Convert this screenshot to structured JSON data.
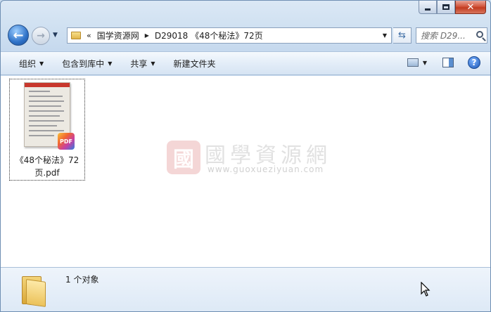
{
  "window": {
    "close_glyph": "✕"
  },
  "nav": {
    "back_glyph": "←",
    "forward_glyph": "→",
    "breadcrumb_sep": "«",
    "breadcrumbs": [
      "国学资源网",
      "D29018 《48个秘法》72页"
    ],
    "search_placeholder": "搜索 D29..."
  },
  "commands": {
    "organize": "组织",
    "include_library": "包含到库中",
    "share": "共享",
    "new_folder": "新建文件夹",
    "help_glyph": "?"
  },
  "files": [
    {
      "name": "《48个秘法》72页.pdf",
      "badge": "PDF"
    }
  ],
  "watermark": {
    "seal": "國",
    "title": "國學資源網",
    "url": "www.guoxueziyuan.com"
  },
  "details": {
    "count_text": "1 个对象"
  },
  "colors": {
    "accent_blue": "#2f72c8",
    "close_red": "#c23c20",
    "pdf_red": "#c8372c"
  }
}
